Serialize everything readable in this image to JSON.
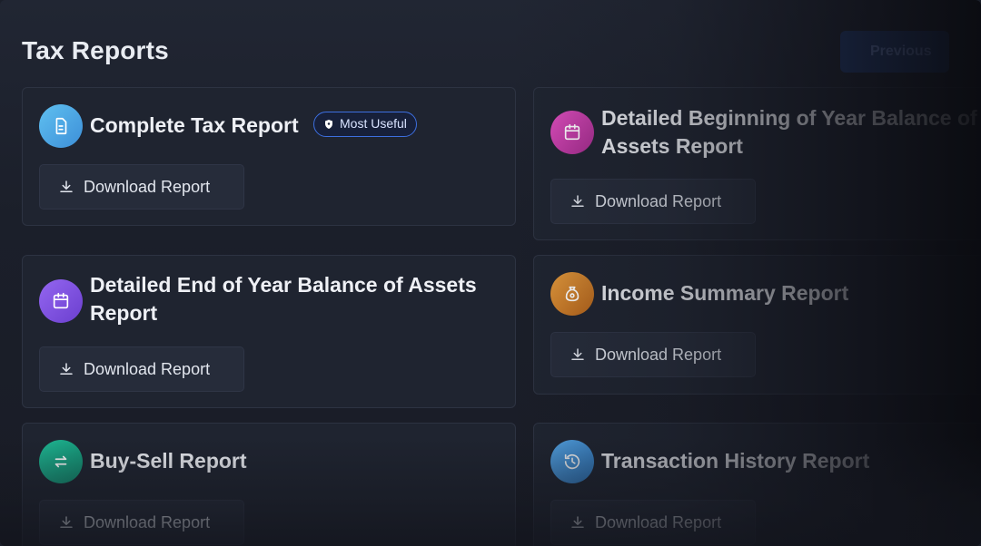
{
  "page": {
    "title": "Tax Reports",
    "previous_label": "Previous"
  },
  "badge_label": "Most Useful",
  "download_label": "Download Report",
  "reports": [
    {
      "title": "Complete Tax Report",
      "icon": "document-icon",
      "color": "#4aa8e6"
    },
    {
      "title": "Detailed Beginning of Year Balance of Assets Report",
      "icon": "calendar-icon",
      "color": "#c13aa6"
    },
    {
      "title": "Detailed End of Year Balance of Assets Report",
      "icon": "calendar-icon",
      "color": "#7c4ddb"
    },
    {
      "title": "Income Summary Report",
      "icon": "money-bag-icon",
      "color": "#c9791f"
    },
    {
      "title": "Buy-Sell Report",
      "icon": "swap-arrows-icon",
      "color": "#17a283"
    },
    {
      "title": "Transaction History Report",
      "icon": "history-clock-icon",
      "color": "#3b8fd1"
    }
  ]
}
